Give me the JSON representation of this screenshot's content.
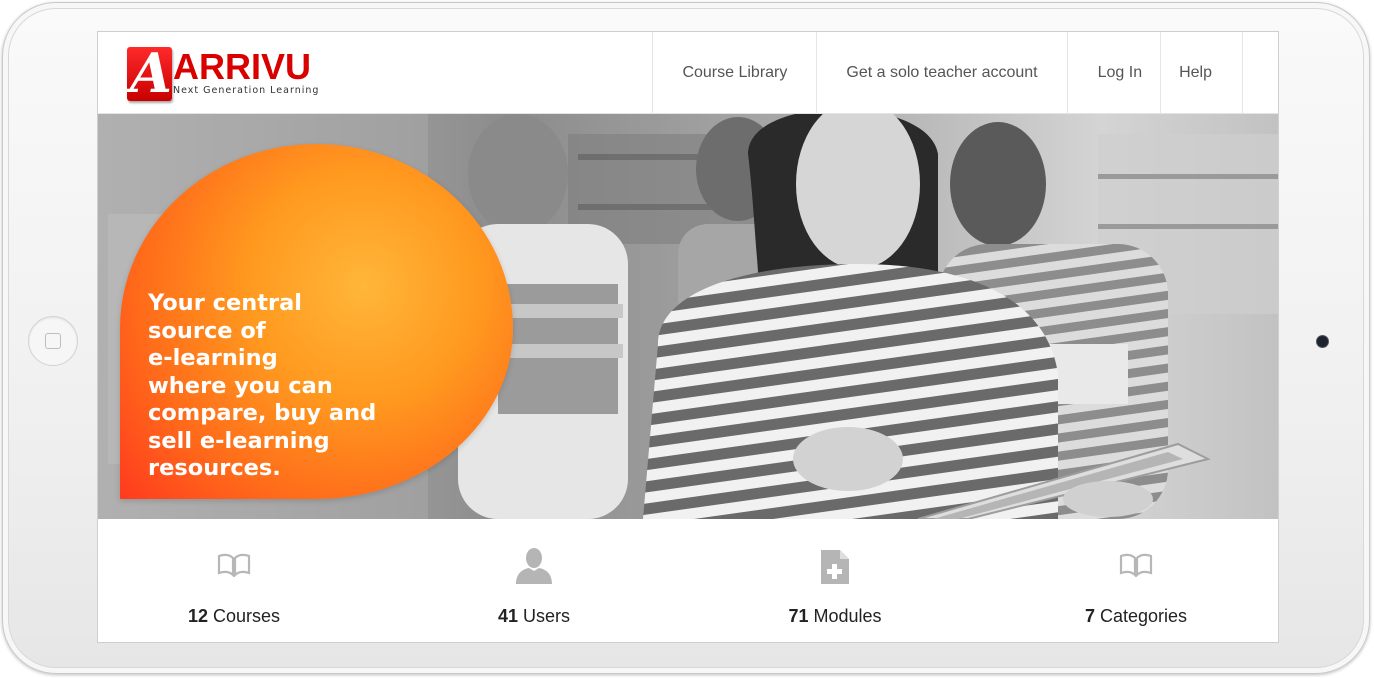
{
  "brand": {
    "mark_letter": "A",
    "name": "ARRIVU",
    "tagline": "Next Generation Learning",
    "accent_color": "#d90000"
  },
  "nav": {
    "items": [
      {
        "label": "Course Library"
      },
      {
        "label": "Get a solo teacher account"
      },
      {
        "label": "Log In"
      },
      {
        "label": "Help"
      }
    ]
  },
  "hero": {
    "headline_lines": [
      "Your central",
      "source of",
      "e-learning",
      "where you can",
      "compare, buy and",
      "sell e-learning",
      "resources."
    ],
    "bubble_color": "#ff7a1a",
    "photo": "grayscale photo of students with books, woman using a tablet"
  },
  "stats": [
    {
      "icon": "book-icon",
      "count": "12",
      "label": "Courses"
    },
    {
      "icon": "user-icon",
      "count": "41",
      "label": "Users"
    },
    {
      "icon": "document-plus-icon",
      "count": "71",
      "label": "Modules"
    },
    {
      "icon": "book-icon",
      "count": "7",
      "label": "Categories"
    }
  ]
}
